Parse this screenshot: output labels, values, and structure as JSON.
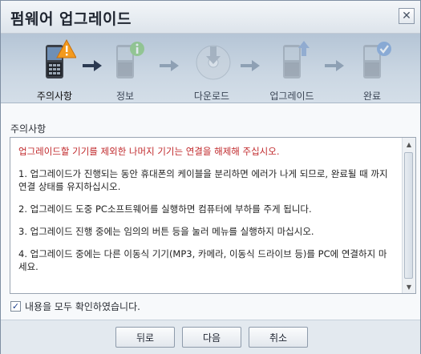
{
  "window": {
    "title": "펌웨어 업그레이드",
    "close_glyph": "✕"
  },
  "steps": [
    {
      "label": "주의사항",
      "icon": "phone-warning-icon",
      "active": true
    },
    {
      "label": "정보",
      "icon": "phone-info-icon",
      "active": false
    },
    {
      "label": "다운로드",
      "icon": "download-disc-icon",
      "active": false
    },
    {
      "label": "업그레이드",
      "icon": "phone-upgrade-icon",
      "active": false
    },
    {
      "label": "완료",
      "icon": "phone-check-icon",
      "active": false
    }
  ],
  "notice": {
    "section_label": "주의사항",
    "warning": "업그레이드할 기기를 제외한 나머지 기기는 연결을 해제해 주십시오.",
    "items": [
      "1. 업그레이드가 진행되는 동안 휴대폰의 케이블을 분리하면 에러가 나게 되므로, 완료될 때 까지 연결 상태를 유지하십시오.",
      "2. 업그레이드 도중 PC소프트웨어를 실행하면 컴퓨터에 부하를 주게 됩니다.",
      "3. 업그레이드 진행 중에는 임의의 버튼 등을 눌러 메뉴를 실행하지 마십시오.",
      "4. 업그레이드 중에는 다른 이동식 기기(MP3, 카메라, 이동식 드라이브 등)를 PC에 연결하지 마세요."
    ]
  },
  "confirm": {
    "checked": true,
    "label": "내용을 모두 확인하였습니다."
  },
  "buttons": {
    "back": "뒤로",
    "next": "다음",
    "cancel": "취소"
  },
  "colors": {
    "warning_text": "#c0282b",
    "active_arrow": "#2b3a52",
    "inactive_arrow": "#8ea0b4"
  }
}
